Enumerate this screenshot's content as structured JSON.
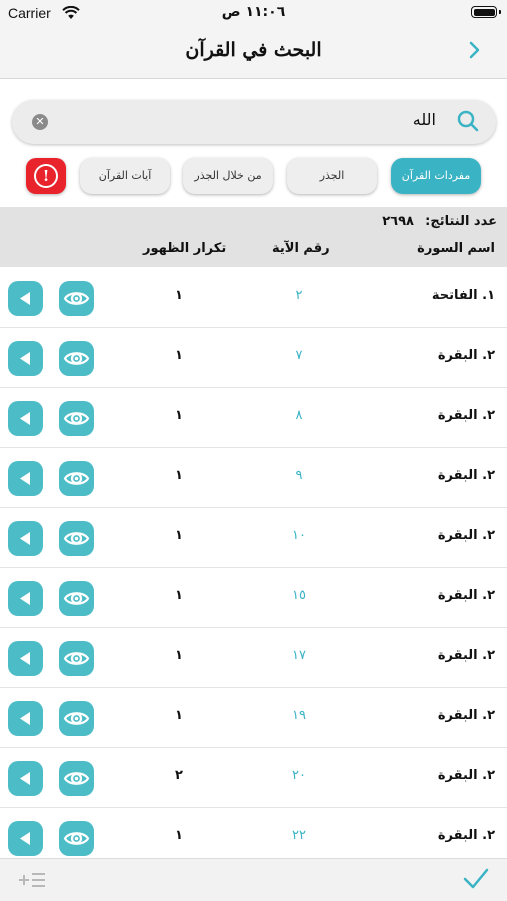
{
  "status": {
    "carrier": "Carrier",
    "time": "١١:٠٦ ص"
  },
  "nav": {
    "title": "البحث في القرآن",
    "back_icon": "chevron-right-icon"
  },
  "search": {
    "query": "الله",
    "icon": "search-icon",
    "clear_icon": "clear-icon"
  },
  "tabs": [
    {
      "label": "مفردات القرآن",
      "active": true
    },
    {
      "label": "الجذر",
      "active": false
    },
    {
      "label": "من خلال الجذر",
      "active": false
    },
    {
      "label": "آيات القرآن",
      "active": false
    }
  ],
  "info_icon": "info-icon",
  "results": {
    "count_label": "عدد النتائج:",
    "count_value": "٢٦٩٨",
    "columns": {
      "surah": "اسم السورة",
      "ayah": "رقم الآية",
      "occurrences": "تكرار الظهور"
    },
    "rows": [
      {
        "surah": "١. الفاتحة",
        "ayah": "٢",
        "occurrences": "١"
      },
      {
        "surah": "٢. البقرة",
        "ayah": "٧",
        "occurrences": "١"
      },
      {
        "surah": "٢. البقرة",
        "ayah": "٨",
        "occurrences": "١"
      },
      {
        "surah": "٢. البقرة",
        "ayah": "٩",
        "occurrences": "١"
      },
      {
        "surah": "٢. البقرة",
        "ayah": "١٠",
        "occurrences": "١"
      },
      {
        "surah": "٢. البقرة",
        "ayah": "١٥",
        "occurrences": "١"
      },
      {
        "surah": "٢. البقرة",
        "ayah": "١٧",
        "occurrences": "١"
      },
      {
        "surah": "٢. البقرة",
        "ayah": "١٩",
        "occurrences": "١"
      },
      {
        "surah": "٢. البقرة",
        "ayah": "٢٠",
        "occurrences": "٢"
      },
      {
        "surah": "٢. البقرة",
        "ayah": "٢٢",
        "occurrences": "١"
      }
    ]
  },
  "toolbar": {
    "left_icon": "add-to-list-icon",
    "right_icon": "checkmark-icon"
  },
  "colors": {
    "accent": "#3ab3c4",
    "button": "#4cbcc6",
    "info": "#e8232b"
  }
}
